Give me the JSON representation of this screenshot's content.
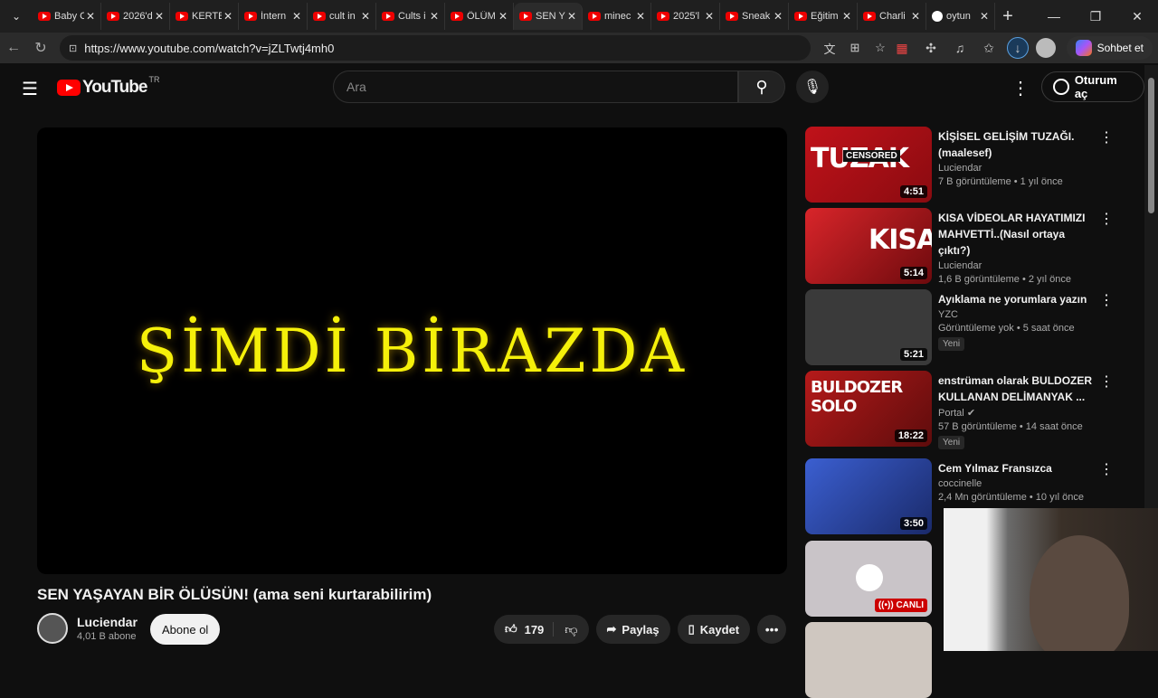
{
  "browser": {
    "tabs": [
      {
        "title": "Baby C",
        "icon": "youtube-icon"
      },
      {
        "title": "2026'd",
        "icon": "youtube-icon"
      },
      {
        "title": "KERTB",
        "icon": "youtube-icon"
      },
      {
        "title": "İntern",
        "icon": "youtube-icon"
      },
      {
        "title": "cult in",
        "icon": "youtube-icon"
      },
      {
        "title": "Cults i",
        "icon": "youtube-icon"
      },
      {
        "title": "ÖLÜM",
        "icon": "youtube-icon"
      },
      {
        "title": "SEN Y",
        "icon": "youtube-icon",
        "active": true
      },
      {
        "title": "minec",
        "icon": "youtube-icon"
      },
      {
        "title": "2025'l",
        "icon": "youtube-icon"
      },
      {
        "title": "Sneak",
        "icon": "youtube-icon"
      },
      {
        "title": "Eğitim",
        "icon": "youtube-icon"
      },
      {
        "title": "Charli",
        "icon": "youtube-icon"
      },
      {
        "title": "oytun",
        "icon": "google-icon"
      }
    ],
    "url": "https://www.youtube.com/watch?v=jZLTwtj4mh0",
    "chat_label": "Sohbet et"
  },
  "header": {
    "logo_text": "YouTube",
    "country": "TR",
    "search_placeholder": "Ara",
    "signin_label": "Oturum aç"
  },
  "video": {
    "overlay_text": "ŞİMDİ BİRAZDA",
    "title": "SEN YAŞAYAN BİR ÖLÜSÜN! (ama seni kurtarabilirim)",
    "channel": "Luciendar",
    "subscribers": "4,01 B abone",
    "subscribe_label": "Abone ol",
    "likes": "179",
    "share_label": "Paylaş",
    "save_label": "Kaydet"
  },
  "recommendations": [
    {
      "title": "KİŞİSEL GELİŞİM TUZAĞI. (maalesef)",
      "channel": "Luciendar",
      "meta": "7 B görüntüleme • 1 yıl önce",
      "duration": "4:51",
      "thumb_text": "TUZAK",
      "thumb_tag": "CENSORED"
    },
    {
      "title": "KISA VİDEOLAR HAYATIMIZI MAHVETTİ..(Nasıl ortaya çıktı?)",
      "channel": "Luciendar",
      "meta": "1,6 B görüntüleme • 2 yıl önce",
      "duration": "5:14",
      "thumb_text": "KISA"
    },
    {
      "title": "Ayıklama ne yorumlara yazın",
      "channel": "YZC",
      "meta": "Görüntüleme yok • 5 saat önce",
      "duration": "5:21",
      "badge": "Yeni"
    },
    {
      "title": "enstrüman olarak BULDOZER KULLANAN DELİMANYAK ...",
      "channel": "Portal",
      "meta": "57 B görüntüleme • 14 saat önce",
      "duration": "18:22",
      "badge": "Yeni",
      "thumb_text": "BULDOZER SOLO"
    },
    {
      "title": "Cem Yılmaz Fransızca",
      "channel": "coccinelle",
      "meta": "2,4 Mn görüntüleme • 10 yıl önce",
      "duration": "3:50"
    },
    {
      "title": "",
      "channel": "",
      "meta": "",
      "live": "CANLI"
    },
    {
      "title": "",
      "channel": "",
      "meta": ""
    }
  ]
}
